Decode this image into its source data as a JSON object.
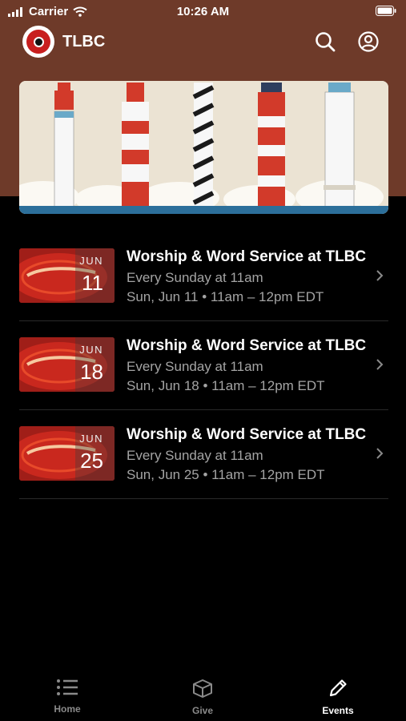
{
  "status_bar": {
    "carrier": "Carrier",
    "time": "10:26 AM"
  },
  "header": {
    "brand": "TLBC",
    "icons": [
      "search-icon",
      "account-icon"
    ]
  },
  "events": [
    {
      "thumb_month": "JUN",
      "thumb_day": "11",
      "title": "Worship & Word Service at TLBC",
      "recurrence": "Every Sunday at 11am",
      "when": "Sun, Jun 11 • 11am – 12pm EDT"
    },
    {
      "thumb_month": "JUN",
      "thumb_day": "18",
      "title": "Worship & Word Service at TLBC",
      "recurrence": "Every Sunday at 11am",
      "when": "Sun, Jun 18 • 11am – 12pm EDT"
    },
    {
      "thumb_month": "JUN",
      "thumb_day": "25",
      "title": "Worship & Word Service at TLBC",
      "recurrence": "Every Sunday at 11am",
      "when": "Sun, Jun 25 • 11am – 12pm EDT"
    }
  ],
  "tab_bar": {
    "tabs": [
      {
        "label": "Home",
        "icon": "list-icon",
        "active": false
      },
      {
        "label": "Give",
        "icon": "gift-box-icon",
        "active": false
      },
      {
        "label": "Events",
        "icon": "pencil-icon",
        "active": true
      }
    ]
  },
  "colors": {
    "header_bg": "#6e3a29",
    "accent_red": "#c81e1e",
    "muted_text": "#a4a4a4",
    "tab_inactive": "#8a8a8a"
  }
}
